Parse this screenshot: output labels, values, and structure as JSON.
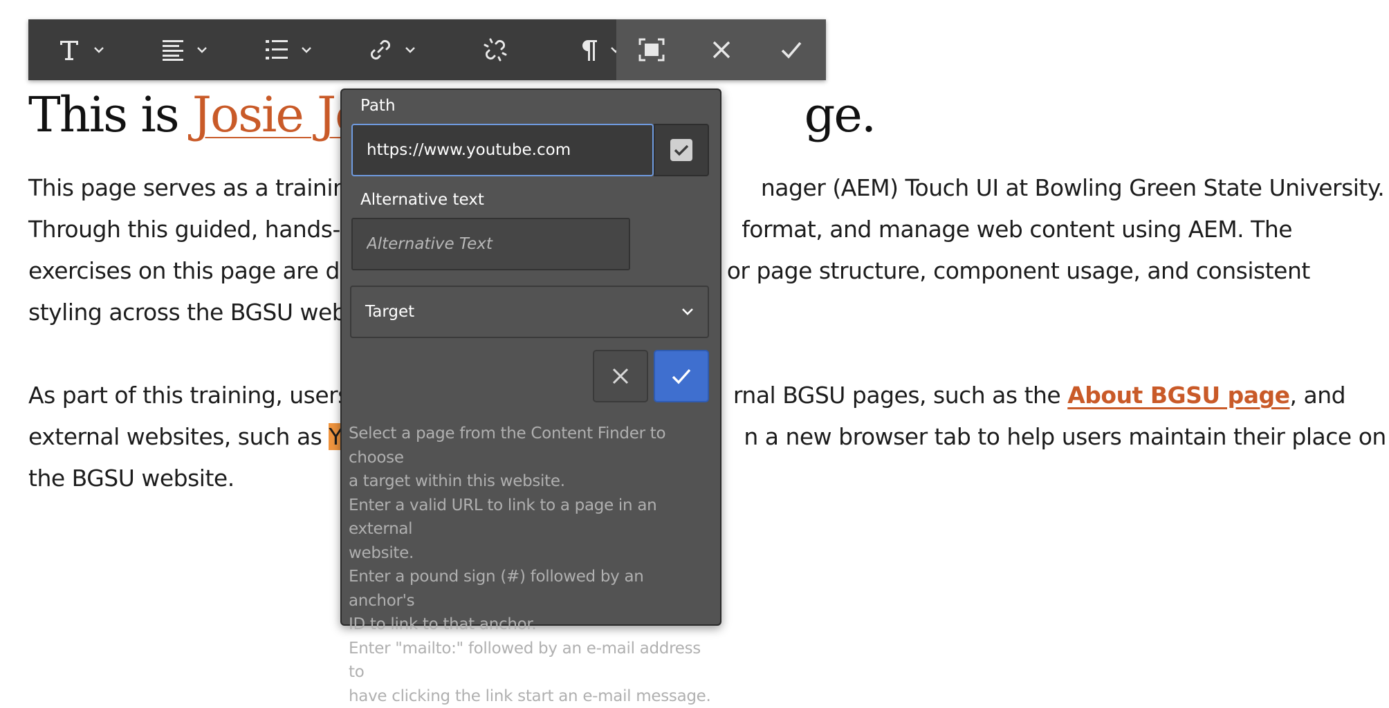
{
  "page": {
    "title_before": "This is ",
    "title_name": "Josie Jonc",
    "title_after": "ge.",
    "para1": [
      "This page serves as a training",
      "Through this guided, hands-o",
      "exercises on this page are de",
      "styling across the BGSU web"
    ],
    "para1_right": [
      "nager (AEM) Touch UI at Bowling Green State University.",
      "format, and manage web content using AEM. The",
      "or page structure, component usage, and consistent",
      ""
    ],
    "para2_l1_left": "As part of this training, users",
    "para2_l1_mid": "rnal BGSU pages, such as the ",
    "para2_l1_link": "About BGSU page",
    "para2_l1_end": ", and",
    "para2_l2_left": "external websites, such as ",
    "para2_l2_sel": "Yo",
    "para2_l2_right": "n a new browser tab to help users maintain their place on",
    "para2_l3": "the BGSU website."
  },
  "toolbar": {
    "items": [
      {
        "icon": "text-format-icon",
        "has_menu": true
      },
      {
        "icon": "align-left-icon",
        "has_menu": true
      },
      {
        "icon": "list-icon",
        "has_menu": true
      },
      {
        "icon": "link-icon",
        "has_menu": true
      },
      {
        "icon": "unlink-icon",
        "has_menu": false
      },
      {
        "icon": "paragraph-icon",
        "has_menu": true
      }
    ],
    "right": [
      "fullscreen-icon",
      "close-icon",
      "checkmark-icon"
    ]
  },
  "dialog": {
    "path_label": "Path",
    "path_value": "https://www.youtube.com",
    "alt_label": "Alternative text",
    "alt_placeholder": "Alternative Text",
    "target_label": "Target",
    "help": [
      "Select a page from the Content Finder to choose",
      "a target within this website.",
      "Enter a valid URL to link to a page in an external",
      "website.",
      "Enter a pound sign (#) followed by an anchor's",
      "ID to link to that anchor.",
      "Enter \"mailto:\" followed by an e-mail address to",
      "have clicking the link start an e-mail message."
    ]
  },
  "colors": {
    "link_orange": "#c95a28",
    "selection": "#f0953f",
    "toolbar_bg": "#3c3c3c",
    "dialog_bg": "#535353",
    "confirm_blue": "#3f6fcf"
  }
}
